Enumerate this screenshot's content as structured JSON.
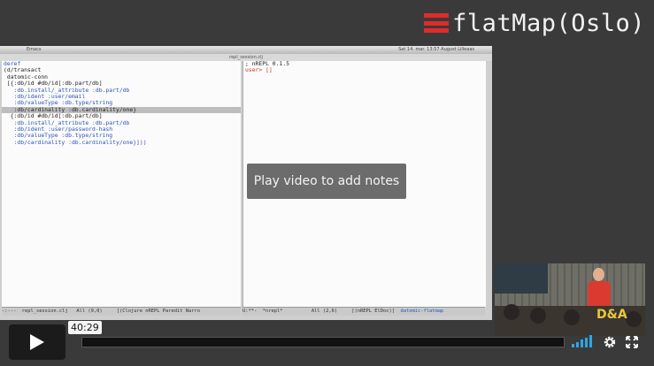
{
  "branding": {
    "title": "flatMap(Oslo)",
    "accent": "#e12a2a"
  },
  "emacs": {
    "window_title": "Emacs",
    "buffer_title": "repl_session.clj",
    "menubar_status": "Sat 14. mar. 13:57   August Lilleaas",
    "left_lines": [
      {
        "text": "deref",
        "cls": "blue"
      },
      {
        "text": "(d/transact",
        "cls": ""
      },
      {
        "text": " datomic-conn",
        "cls": ""
      },
      {
        "text": " [{:db/id #db/id[:db.part/db]",
        "cls": ""
      },
      {
        "text": "   :db.install/_attribute :db.part/db",
        "cls": "blue"
      },
      {
        "text": "   :db/ident :user/email",
        "cls": "blue"
      },
      {
        "text": "   :db/valueType :db.type/string",
        "cls": "blue"
      },
      {
        "text": "   :db/cardinality :db.cardinality/one}",
        "cls": "hl"
      },
      {
        "text": "",
        "cls": ""
      },
      {
        "text": "  {:db/id #db/id[:db.part/db]",
        "cls": ""
      },
      {
        "text": "   :db.install/_attribute :db.part/db",
        "cls": "blue"
      },
      {
        "text": "   :db/ident :user/password-hash",
        "cls": "blue"
      },
      {
        "text": "   :db/valueType :db.type/string",
        "cls": "blue"
      },
      {
        "text": "   :db/cardinality :db.cardinality/one}]))",
        "cls": "blue"
      }
    ],
    "right_lines": [
      {
        "text": "; nREPL 0.1.5",
        "cls": ""
      },
      {
        "text": "user> []",
        "cls": "red"
      }
    ],
    "modeline_left": "-:---  repl_session.clj   All (9,0)     [(Clojure nREPL Paredit Narro",
    "modeline_right": "U:**-  *nrepl*          All (2,6)     [(nREPL ElDoc)]  ",
    "modeline_right_tail": "datomic-flatmap"
  },
  "overlay": {
    "notes_label": "Play video to add notes"
  },
  "camera": {
    "logo_text": "D&A"
  },
  "player": {
    "timecode": "40:29",
    "progress_fraction": 0.0,
    "volume_level": 5,
    "play_icon": "play-icon",
    "settings_icon": "gear-icon",
    "fullscreen_icon": "fullscreen-icon",
    "volume_icon": "volume-bars-icon",
    "progress_color": "#5a5a5a",
    "volume_color": "#2fa6e3"
  }
}
